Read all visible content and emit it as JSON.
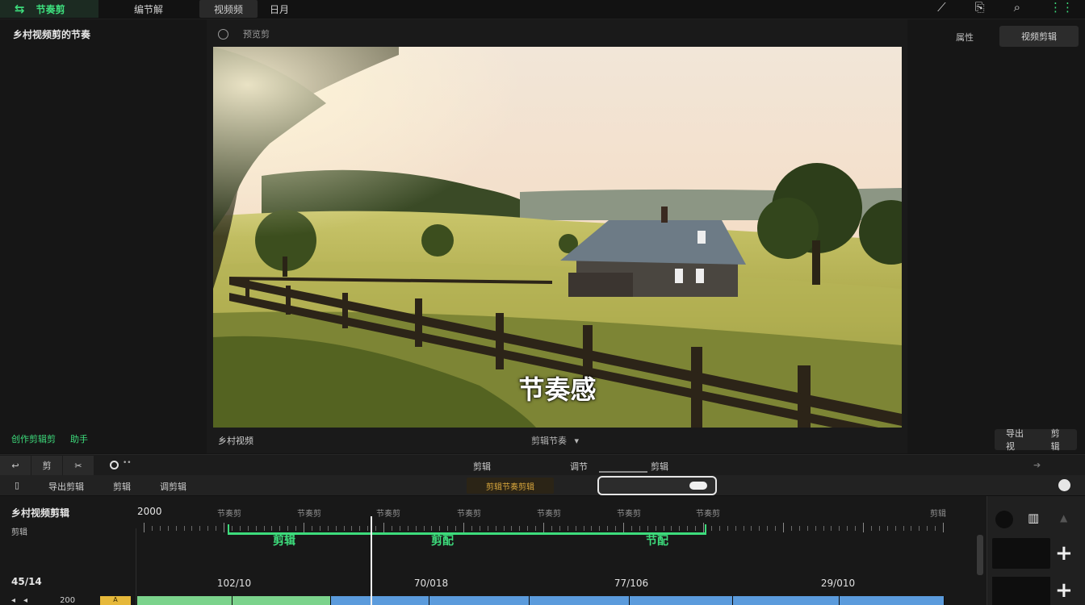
{
  "app": {
    "brand_icon": "transition-icon",
    "brand_name": "节奏剪"
  },
  "top_nav": [
    "编节解",
    "视频频",
    "日月"
  ],
  "top_icons": [
    "magic-wand-icon",
    "export-icon",
    "comment-icon",
    "menu-icon"
  ],
  "left_panel": {
    "title": "乡村视频剪的节奏",
    "footer_a": "创作剪辑剪",
    "footer_b": "助手"
  },
  "preview": {
    "header_label": "预览剪",
    "subtitle": "节奏感",
    "footer_left": "乡村视频",
    "footer_center": "剪辑节奏"
  },
  "right_panel": {
    "label": "属性",
    "button": "视频剪辑",
    "footer_a": "导出视",
    "footer_b": "剪辑"
  },
  "toolbar1": {
    "buttons": [
      "↩",
      "剪",
      "✂"
    ],
    "center_a": "剪辑",
    "center_b": "调节",
    "center_c": "剪辑"
  },
  "toolbar2": {
    "buttons": [
      "导出剪辑",
      "剪辑",
      "调剪辑"
    ],
    "tag": "剪辑节奏剪辑"
  },
  "timeline": {
    "title": "乡村视频剪辑",
    "subtitle": "剪辑",
    "start_time": "2000",
    "tick_labels": [
      "节奏剪",
      "节奏剪",
      "节奏剪",
      "节奏剪",
      "节奏剪",
      "节奏剪",
      "节奏剪",
      "剪辑"
    ],
    "markers": [
      "剪辑",
      "剪配",
      "节配"
    ],
    "timestamps": [
      "102/10",
      "70/018",
      "77/106",
      "29/010"
    ],
    "track_time": "45/14",
    "track_num": "200",
    "clip_colors": [
      "#7bd38c",
      "#7bd38c",
      "#5b9bdc",
      "#5b9bdc",
      "#5b9bdc",
      "#5b9bdc",
      "#5b9bdc",
      "#5b9bdc"
    ]
  },
  "colors": {
    "accent": "#3ddc7c",
    "panel": "#161616",
    "clip_green": "#7bd38c",
    "clip_blue": "#5b9bdc",
    "tag_gold": "#d6a53c"
  }
}
